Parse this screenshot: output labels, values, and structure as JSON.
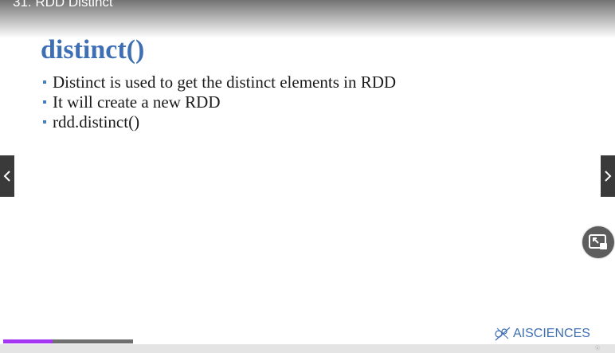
{
  "player": {
    "title": "31. RDD Distinct",
    "progress_fraction": 0.38,
    "prev_icon": "chevron-left-icon",
    "next_icon": "chevron-right-icon",
    "pip_icon": "picture-in-picture-icon",
    "accent_color": "#a435f0"
  },
  "slide": {
    "heading": "distinct()",
    "bullets": [
      "Distinct is used to get the distinct elements in RDD",
      "It will create a new RDD",
      "rdd.distinct()"
    ],
    "heading_color": "#3e6fb4",
    "logo_text": "AISCIENCES"
  }
}
